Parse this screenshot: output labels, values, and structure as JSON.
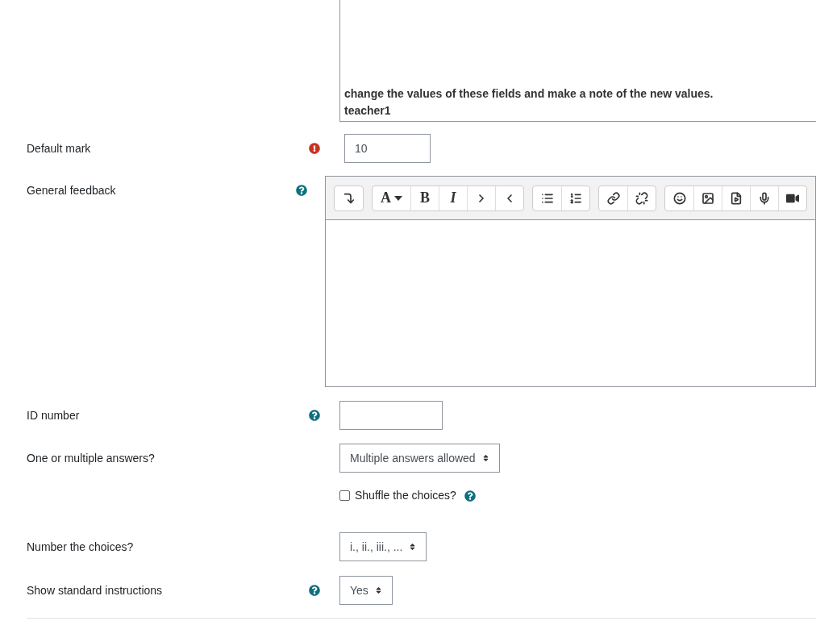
{
  "top_editor": {
    "lines": [
      "change the values of these fields and make a note of the new values.",
      "teacher1"
    ]
  },
  "rows": [
    {
      "label": "Default mark",
      "error": true,
      "control": {
        "kind": "text",
        "value": "10"
      }
    },
    {
      "label": "General feedback",
      "help": true,
      "control": {
        "kind": "editor",
        "toolbar": [
          [
            {
              "kind": "icon"
            }
          ],
          [
            {
              "kind": "text",
              "label": "A",
              "caret": true
            },
            {
              "kind": "text",
              "label": "B"
            },
            {
              "kind": "text",
              "label": "I",
              "italic": true
            },
            {
              "kind": "icon"
            },
            {
              "kind": "icon"
            }
          ],
          [
            {
              "kind": "icon"
            },
            {
              "kind": "icon"
            }
          ],
          [
            {
              "kind": "icon"
            },
            {
              "kind": "icon"
            }
          ],
          [
            {
              "kind": "icon"
            },
            {
              "kind": "icon"
            },
            {
              "kind": "icon"
            },
            {
              "kind": "icon"
            },
            {
              "kind": "icon"
            }
          ]
        ]
      }
    },
    {
      "label": "ID number",
      "help": true,
      "control": {
        "kind": "text"
      }
    },
    {
      "label": "One or multiple answers?",
      "control": {
        "kind": "select",
        "value": "Multiple answers allowed"
      }
    },
    {
      "control": {
        "kind": "checkbox",
        "label": "Shuffle the choices?",
        "checked": false,
        "help": true
      }
    },
    {
      "label": "Number the choices?",
      "control": {
        "kind": "select",
        "value": "i., ii., iii., ..."
      }
    },
    {
      "label": "Show standard instructions",
      "help": true,
      "control": {
        "kind": "select",
        "value": "Yes"
      }
    }
  ]
}
